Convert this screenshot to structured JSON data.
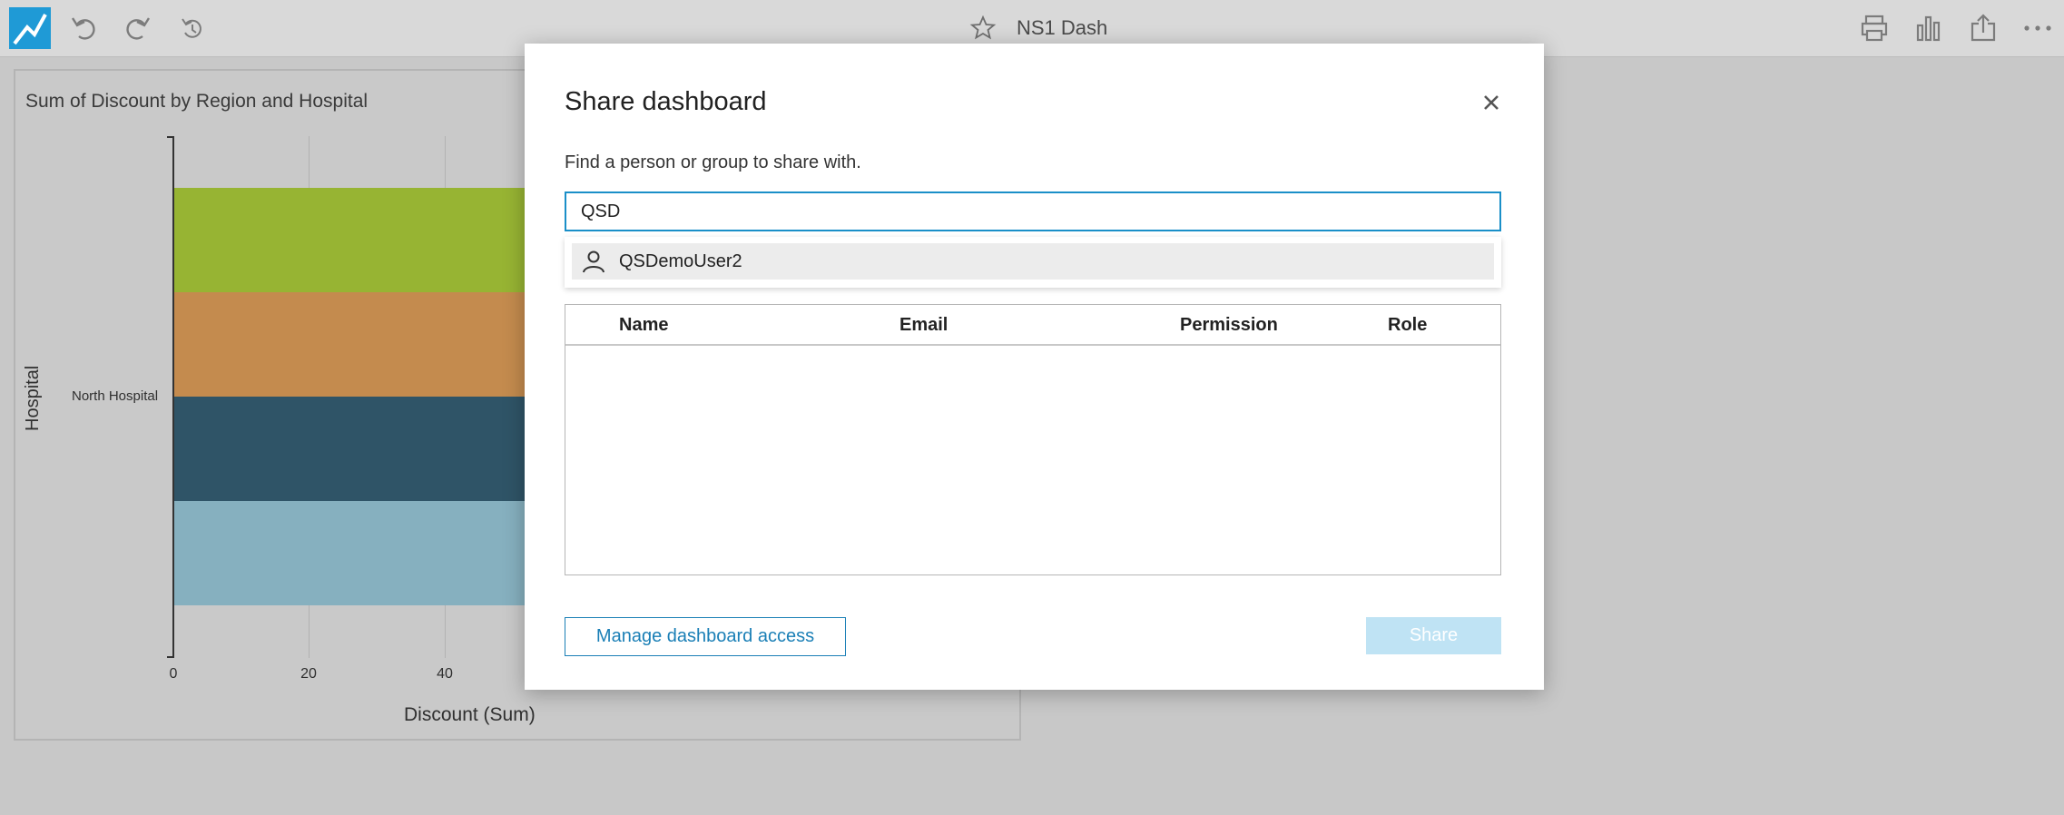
{
  "topbar": {
    "title": "NS1 Dash",
    "icons": [
      "undo-icon",
      "redo-icon",
      "reset-icon",
      "star-icon",
      "print-icon",
      "chart-icon",
      "share-icon",
      "more-icon"
    ]
  },
  "visual": {
    "title": "Sum of Discount by Region and Hospital",
    "chart_data": {
      "type": "bar",
      "orientation": "horizontal",
      "stacked": true,
      "categories": [
        "North Hospital"
      ],
      "xlabel": "Discount (Sum)",
      "ylabel": "Hospital",
      "x_ticks": [
        "0",
        "20",
        "40"
      ],
      "colors": [
        "#97b433",
        "#c48b4e",
        "#2f5467",
        "#86b0bf"
      ],
      "grid": true
    }
  },
  "modal": {
    "title": "Share dashboard",
    "prompt": "Find a person or group to share with.",
    "search_value": "QSD",
    "suggestion": "QSDemoUser2",
    "columns": {
      "name": "Name",
      "email": "Email",
      "permission": "Permission",
      "role": "Role"
    },
    "manage_label": "Manage dashboard access",
    "share_label": "Share"
  }
}
